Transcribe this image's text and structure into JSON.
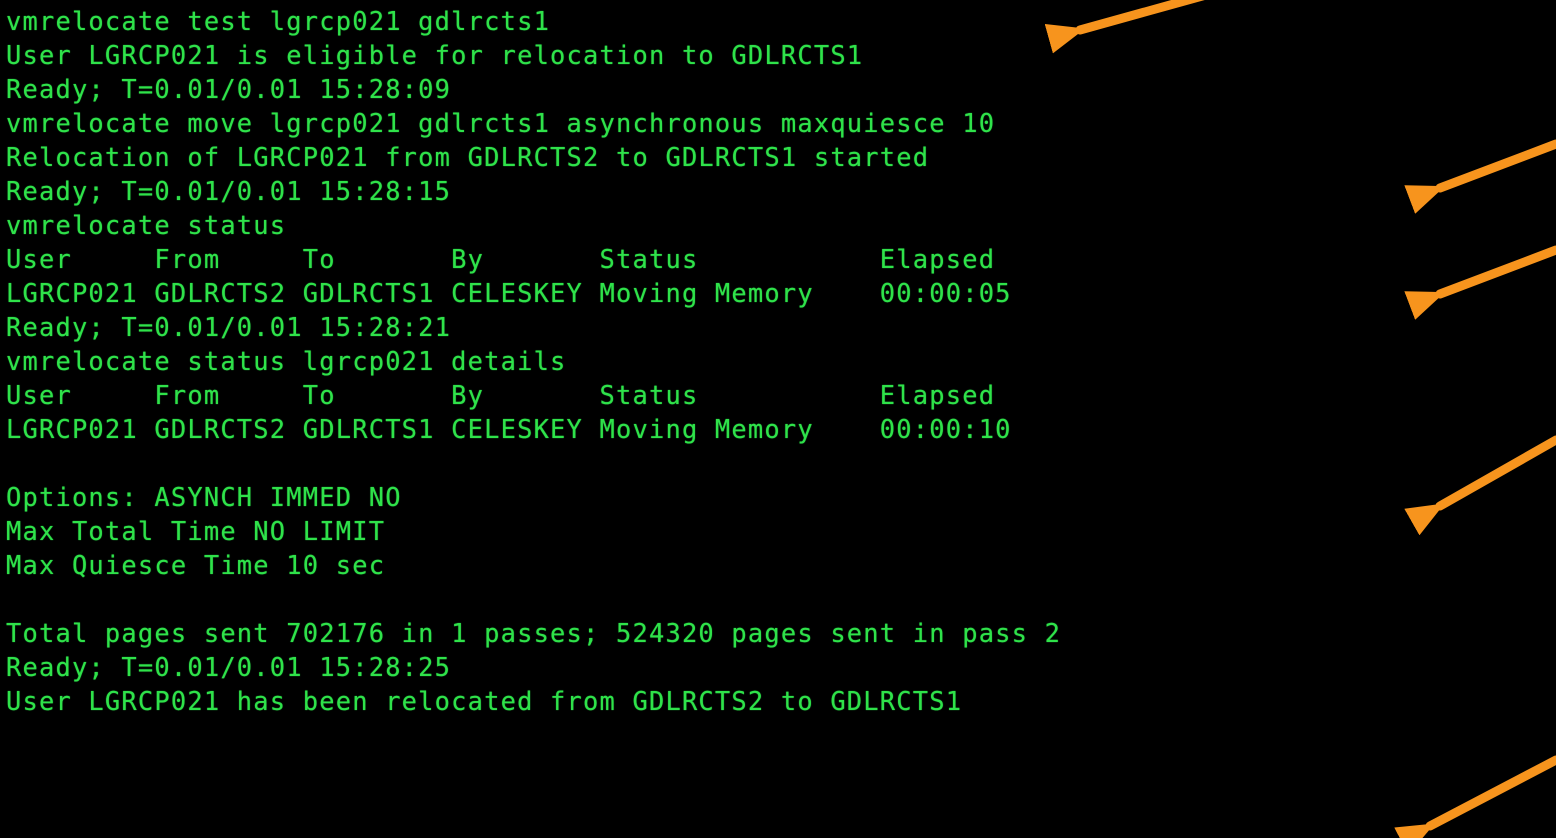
{
  "terminal": {
    "lines": [
      "vmrelocate test lgrcp021 gdlrcts1",
      "User LGRCP021 is eligible for relocation to GDLRCTS1",
      "Ready; T=0.01/0.01 15:28:09",
      "vmrelocate move lgrcp021 gdlrcts1 asynchronous maxquiesce 10",
      "Relocation of LGRCP021 from GDLRCTS2 to GDLRCTS1 started",
      "Ready; T=0.01/0.01 15:28:15",
      "vmrelocate status",
      "User     From     To       By       Status           Elapsed",
      "LGRCP021 GDLRCTS2 GDLRCTS1 CELESKEY Moving Memory    00:00:05",
      "Ready; T=0.01/0.01 15:28:21",
      "vmrelocate status lgrcp021 details",
      "User     From     To       By       Status           Elapsed",
      "LGRCP021 GDLRCTS2 GDLRCTS1 CELESKEY Moving Memory    00:00:10",
      "",
      "Options: ASYNCH IMMED NO",
      "Max Total Time NO LIMIT",
      "Max Quiesce Time 10 sec",
      "",
      "Total pages sent 702176 in 1 passes; 524320 pages sent in pass 2",
      "Ready; T=0.01/0.01 15:28:25",
      "User LGRCP021 has been relocated from GDLRCTS2 to GDLRCTS1"
    ]
  },
  "colors": {
    "background": "#000000",
    "text": "#2fe24a",
    "arrow": "#f7941d"
  },
  "annotations": [
    {
      "name": "arrow-test-command"
    },
    {
      "name": "arrow-move-command"
    },
    {
      "name": "arrow-status-elapsed"
    },
    {
      "name": "arrow-details-elapsed"
    },
    {
      "name": "arrow-relocated-message"
    }
  ]
}
